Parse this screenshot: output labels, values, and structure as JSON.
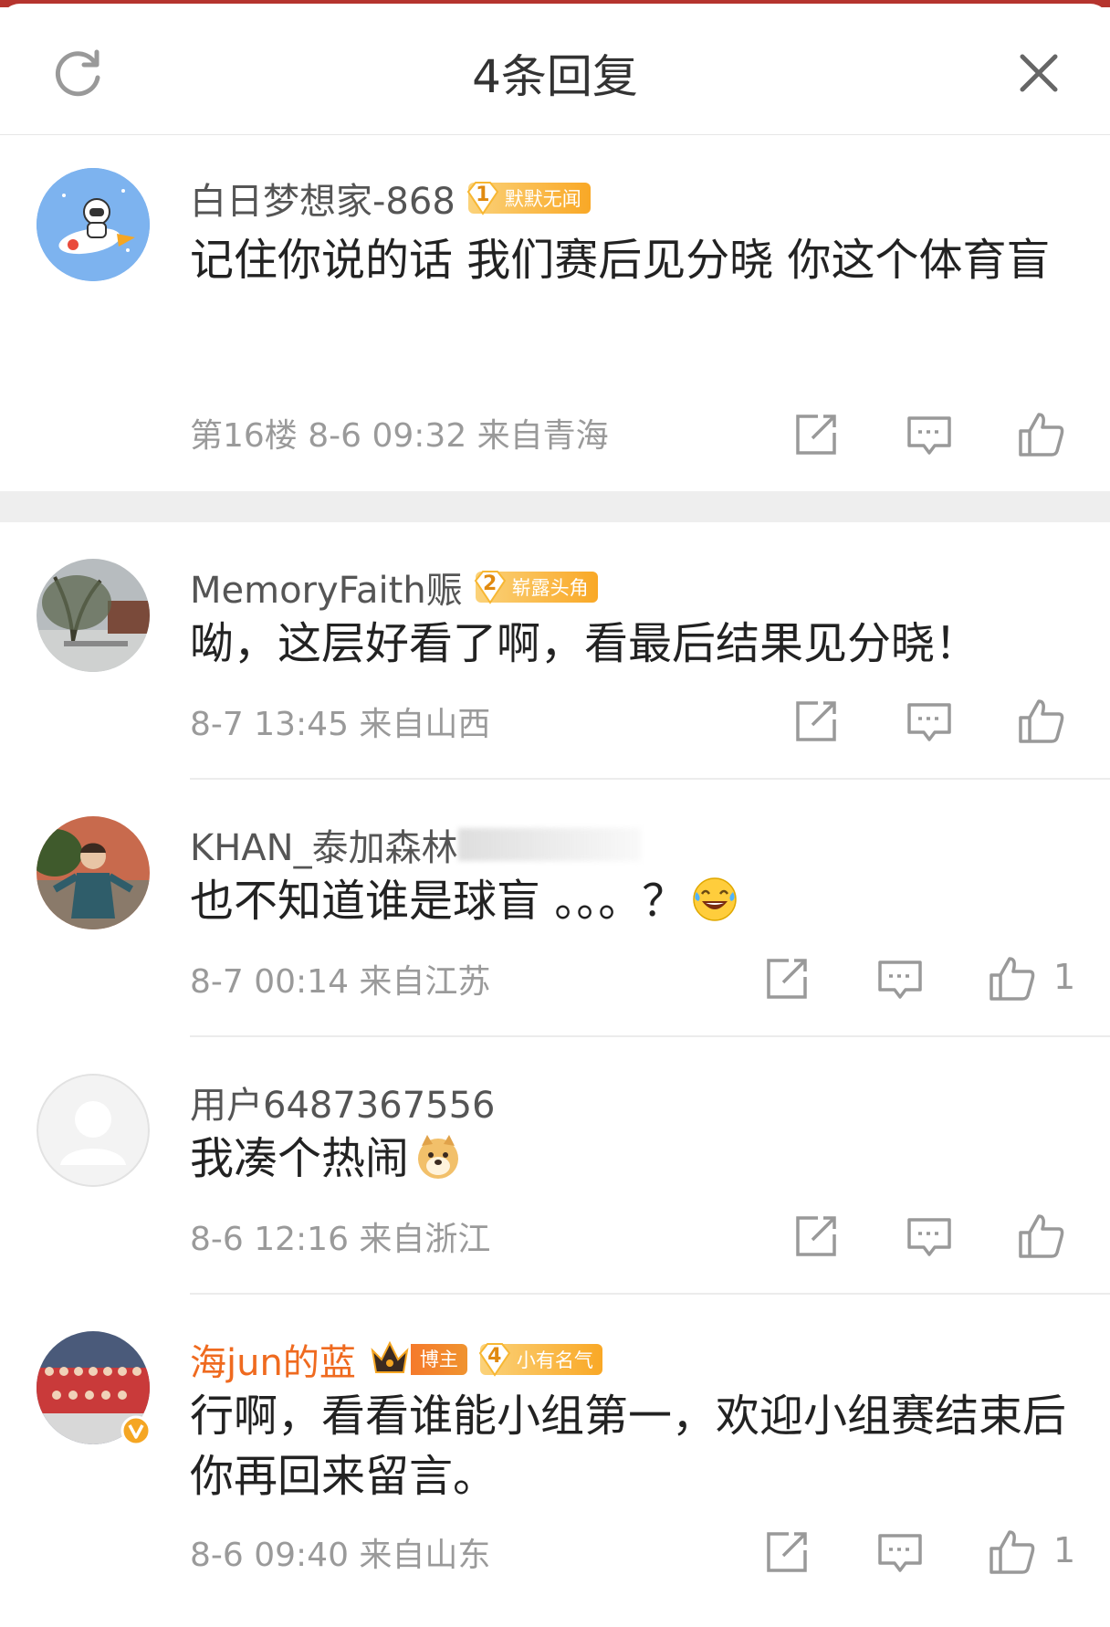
{
  "header": {
    "title": "4条回复",
    "refresh_icon": "refresh-icon",
    "close_icon": "close-icon"
  },
  "main_comment": {
    "username": "白日梦想家-868",
    "badge_level": "1",
    "badge_label": "默默无闻",
    "text": "记住你说的话 我们赛后见分晓 你这个体育盲",
    "meta": "第16楼  8-6 09:32  来自青海",
    "like_count": ""
  },
  "replies": [
    {
      "username": "MemoryFaith赈",
      "badge_level": "2",
      "badge_label": "崭露头角",
      "text": "呦，这层好看了啊，看最后结果见分晓！",
      "meta": "8-7 13:45  来自山西",
      "like_count": ""
    },
    {
      "username": "KHAN_泰加森林",
      "text": "也不知道谁是球盲 。。。？",
      "meta": "8-7 00:14  来自江苏",
      "like_count": "1"
    },
    {
      "username": "用户6487367556",
      "text": "我凑个热闹",
      "meta": "8-6 12:16  来自浙江",
      "like_count": ""
    },
    {
      "username": "海jun的蓝",
      "vip_label": "博主",
      "badge_level": "4",
      "badge_label": "小有名气",
      "text": "行啊，看看谁能小组第一，欢迎小组赛结束后你再回来留言。",
      "meta": "8-6 09:40  来自山东",
      "like_count": "1"
    }
  ],
  "colors": {
    "accent_orange": "#ef6a1f",
    "top_strip": "#b5342e",
    "badge_gold": "#f9a826"
  }
}
